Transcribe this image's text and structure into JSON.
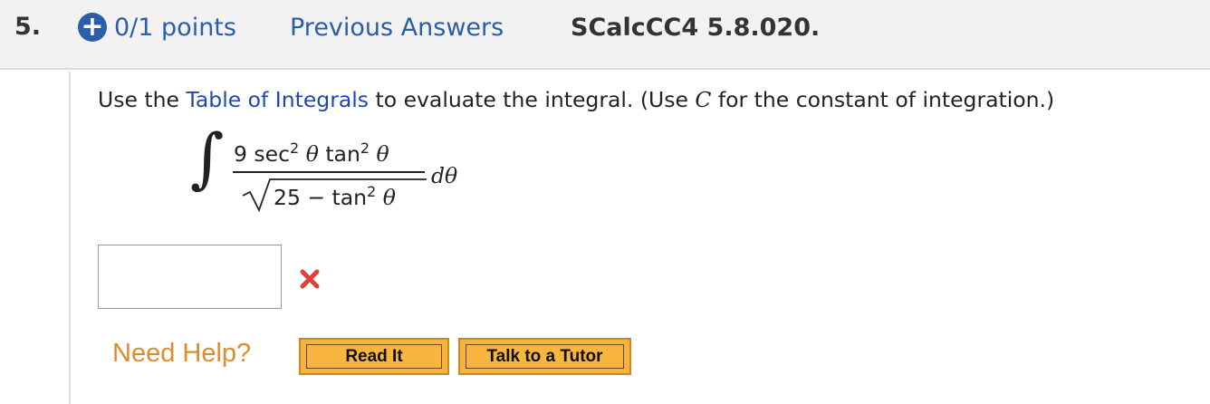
{
  "header": {
    "question_number": "5.",
    "plus_icon": "+",
    "points": "0/1 points",
    "previous_answers": "Previous Answers",
    "problem_code": "SCalcCC4 5.8.020."
  },
  "prompt": {
    "before_link": "Use the ",
    "link": "Table of Integrals",
    "middle": " to evaluate the integral. (Use ",
    "constant": "C",
    "after": " for the constant of integration.)"
  },
  "integral": {
    "sign": "∫",
    "numerator": {
      "coef": "9 sec",
      "exp1": "2",
      "theta1": " θ",
      "tan": " tan",
      "exp2": "2",
      "theta2": " θ"
    },
    "denominator": {
      "lead": "25 − tan",
      "exp": "2",
      "theta": " θ"
    },
    "differential": "dθ"
  },
  "answer": {
    "value": "",
    "status_icon": "incorrect-x-icon"
  },
  "help": {
    "label": "Need Help?",
    "read_it": "Read It",
    "talk_to_tutor": "Talk to a Tutor"
  },
  "colors": {
    "link_blue": "#1f47b3",
    "header_blue": "#2a5ea8",
    "help_orange": "#e08a2e",
    "button_fill": "#f6b33f",
    "wrong_red": "#e0403a"
  }
}
